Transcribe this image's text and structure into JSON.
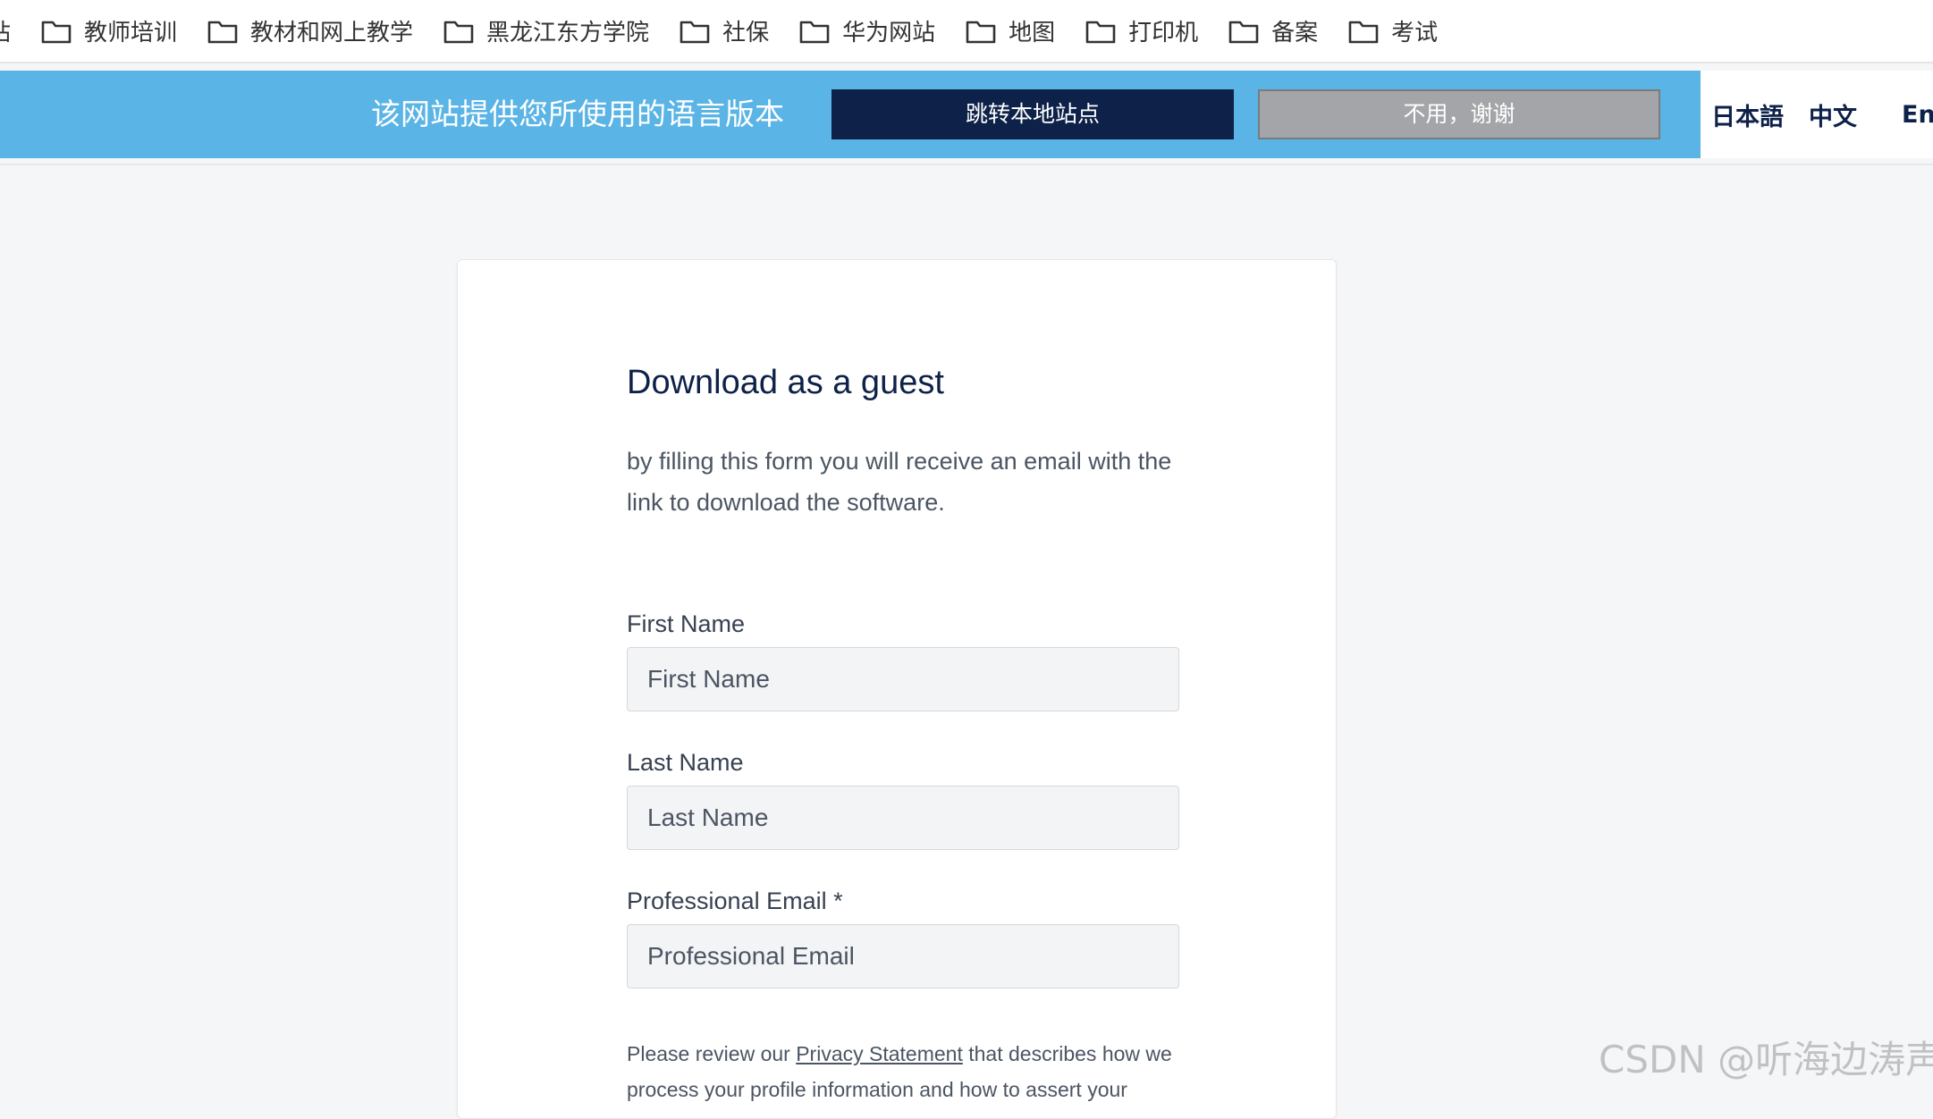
{
  "bookmarks": {
    "cut_label": "站",
    "items": [
      {
        "label": "教师培训"
      },
      {
        "label": "教材和网上教学"
      },
      {
        "label": "黑龙江东方学院"
      },
      {
        "label": "社保"
      },
      {
        "label": "华为网站"
      },
      {
        "label": "地图"
      },
      {
        "label": "打印机"
      },
      {
        "label": "备案"
      },
      {
        "label": "考试"
      }
    ],
    "icon": "folder-icon"
  },
  "lang_banner": {
    "message": "该网站提供您所使用的语言版本",
    "redirect_label": "跳转本地站点",
    "decline_label": "不用，谢谢",
    "languages": [
      "日本語",
      "中文",
      "Eng"
    ],
    "colors": {
      "background": "#5ab4e5",
      "primary_button": "#0e2149",
      "secondary_button": "#a4a5a8"
    }
  },
  "form": {
    "title": "Download as a guest",
    "description": "by filling this form you will receive an email with the link to download the software.",
    "first_name": {
      "label": "First Name",
      "placeholder": "First Name"
    },
    "last_name": {
      "label": "Last Name",
      "placeholder": "Last Name"
    },
    "email": {
      "label": "Professional Email *",
      "placeholder": "Professional Email"
    },
    "privacy": {
      "before": "Please review our ",
      "link": "Privacy Statement",
      "after": " that describes how we process your profile information and how to assert your"
    }
  },
  "watermark": "CSDN @听海边涛声"
}
